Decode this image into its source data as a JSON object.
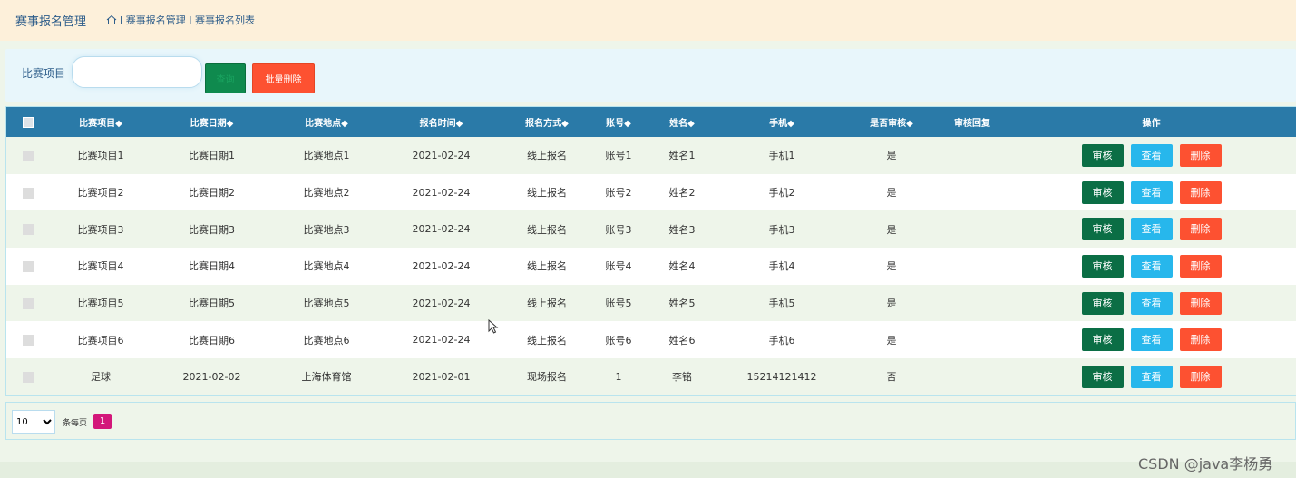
{
  "header": {
    "title": "赛事报名管理",
    "breadcrumb": "I 赛事报名管理 I 赛事报名列表"
  },
  "search": {
    "label": "比赛项目",
    "value": "",
    "search_label": "查询",
    "batch_delete_label": "批量删除"
  },
  "table": {
    "columns": [
      "比赛项目◆",
      "比赛日期◆",
      "比赛地点◆",
      "报名时间◆",
      "报名方式◆",
      "账号◆",
      "姓名◆",
      "手机◆",
      "是否审核◆",
      "审核回复",
      "操作"
    ],
    "rows": [
      [
        "比赛项目1",
        "比赛日期1",
        "比赛地点1",
        "2021-02-24",
        "线上报名",
        "账号1",
        "姓名1",
        "手机1",
        "是",
        ""
      ],
      [
        "比赛项目2",
        "比赛日期2",
        "比赛地点2",
        "2021-02-24",
        "线上报名",
        "账号2",
        "姓名2",
        "手机2",
        "是",
        ""
      ],
      [
        "比赛项目3",
        "比赛日期3",
        "比赛地点3",
        "2021-02-24",
        "线上报名",
        "账号3",
        "姓名3",
        "手机3",
        "是",
        ""
      ],
      [
        "比赛项目4",
        "比赛日期4",
        "比赛地点4",
        "2021-02-24",
        "线上报名",
        "账号4",
        "姓名4",
        "手机4",
        "是",
        ""
      ],
      [
        "比赛项目5",
        "比赛日期5",
        "比赛地点5",
        "2021-02-24",
        "线上报名",
        "账号5",
        "姓名5",
        "手机5",
        "是",
        ""
      ],
      [
        "比赛项目6",
        "比赛日期6",
        "比赛地点6",
        "2021-02-24",
        "线上报名",
        "账号6",
        "姓名6",
        "手机6",
        "是",
        ""
      ],
      [
        "足球",
        "2021-02-02",
        "上海体育馆",
        "2021-02-01",
        "现场报名",
        "1",
        "李铭",
        "15214121412",
        "否",
        ""
      ]
    ],
    "actions": [
      "审核",
      "查看",
      "删除"
    ]
  },
  "pager": {
    "page_size": "10",
    "page_size_options": [
      "10"
    ],
    "per_page_label": "条每页",
    "current_page": "1"
  },
  "watermark": "CSDN @java李杨勇",
  "colors": {
    "header_bg": "#2a7aa8",
    "audit": "#0b6e45",
    "view": "#27b7ec",
    "delete": "#fd5131",
    "page_active": "#d3177a"
  },
  "icons": {
    "home": "home-icon",
    "cursor": "mouse-cursor-icon"
  }
}
